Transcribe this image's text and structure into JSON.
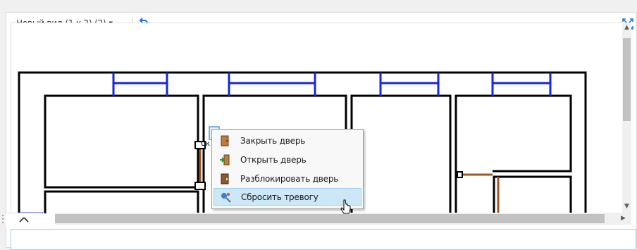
{
  "toolbar": {
    "view_name": "Новый вид (1 x 2) (2)",
    "undo_icon": "undo-icon",
    "fullscreen_icon": "fullscreen-icon"
  },
  "plan": {
    "door_tag": "Ск"
  },
  "context_menu": {
    "items": [
      {
        "label": "Закрыть дверь",
        "icon": "door-closed-icon"
      },
      {
        "label": "Открыть дверь",
        "icon": "door-open-icon"
      },
      {
        "label": "Разблокировать дверь",
        "icon": "door-unlock-icon"
      },
      {
        "label": "Сбросить тревогу",
        "icon": "alarm-reset-icon",
        "highlighted": true
      }
    ]
  },
  "colors": {
    "walls": "#000000",
    "windows": "#1428d8",
    "doors": "#a0561e",
    "menu_highlight": "#cce8f7"
  }
}
